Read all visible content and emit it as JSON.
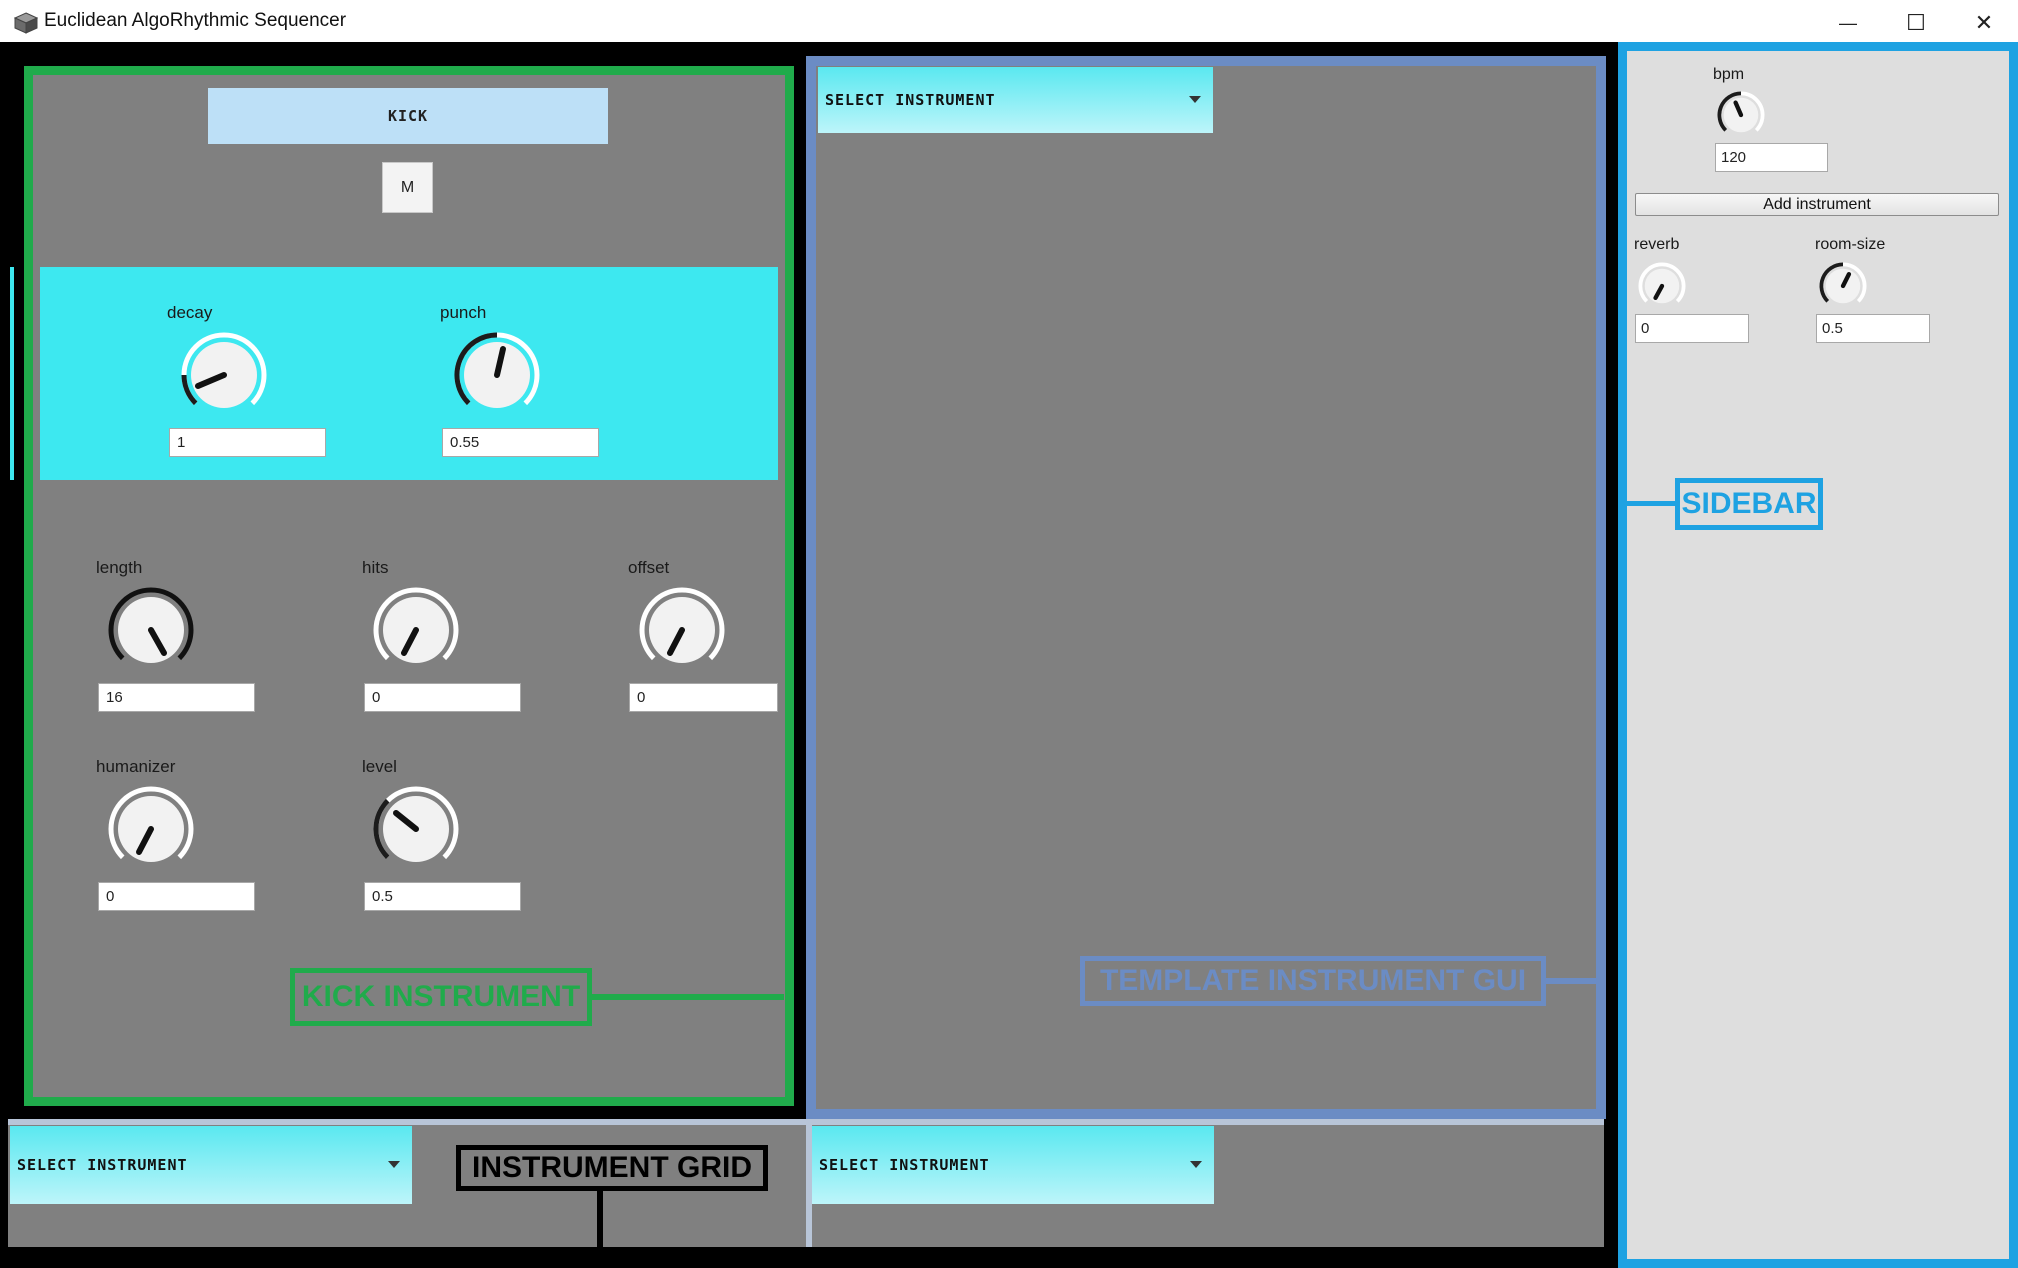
{
  "window": {
    "title": "Euclidean AlgoRhythmic Sequencer",
    "minimize_glyph": "—",
    "maximize_glyph": "☐",
    "close_glyph": "✕"
  },
  "kick": {
    "name": "KICK",
    "mute_label": "M",
    "decay": {
      "label": "decay",
      "value": "1"
    },
    "punch": {
      "label": "punch",
      "value": "0.55"
    },
    "length": {
      "label": "length",
      "value": "16"
    },
    "hits": {
      "label": "hits",
      "value": "0"
    },
    "offset": {
      "label": "offset",
      "value": "0"
    },
    "humanizer": {
      "label": "humanizer",
      "value": "0"
    },
    "level": {
      "label": "level",
      "value": "0.5"
    }
  },
  "template": {
    "select_label": "SELECT INSTRUMENT"
  },
  "grid": {
    "select_1": "SELECT INSTRUMENT",
    "select_2": "SELECT INSTRUMENT"
  },
  "sidebar": {
    "bpm": {
      "label": "bpm",
      "value": "120"
    },
    "add_instrument": "Add instrument",
    "reverb": {
      "label": "reverb",
      "value": "0"
    },
    "room_size": {
      "label": "room-size",
      "value": "0.5"
    }
  },
  "annotations": {
    "kick": "KICK INSTRUMENT",
    "template": "TEMPLATE INSTRUMENT GUI",
    "sidebar": "SIDEBAR",
    "grid": "INSTRUMENT GRID"
  },
  "colors": {
    "kick_frame": "#20ab4b",
    "template_frame": "#6b8cc4",
    "sidebar_frame": "#1ea2e2",
    "synth_panel": "#3de8f0",
    "panel_bg": "#808080"
  }
}
